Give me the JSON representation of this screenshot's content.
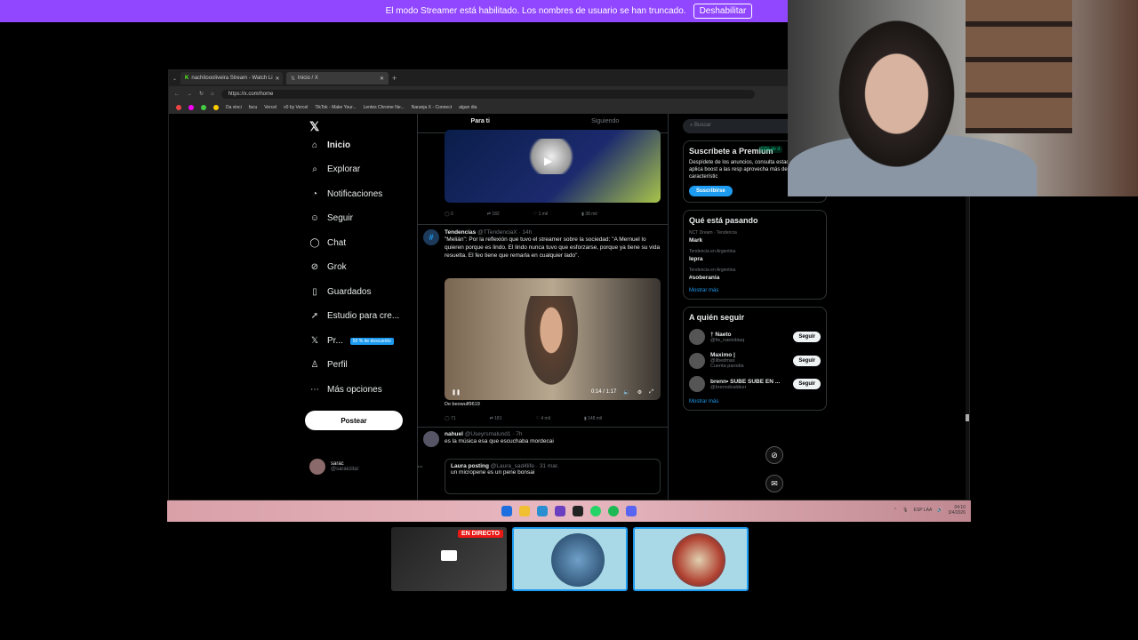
{
  "banner": {
    "text": "El modo Streamer está habilitado. Los nombres de usuario se han truncado.",
    "button": "Deshabilitar"
  },
  "browser": {
    "tabs": [
      {
        "label": "nachitoooliveira Stream - Watch Li"
      },
      {
        "label": "Inicio / X"
      }
    ],
    "url": "https://x.com/home",
    "bookmarks": [
      "Da vinci",
      "facu",
      "Vercel",
      "v0 by Vercel",
      "TikTok - Make Your...",
      "Lentes Chrome Ne...",
      "Naranja X - Connect",
      "algun dia"
    ]
  },
  "nav": {
    "items": [
      {
        "label": "Inicio",
        "icon": "home-icon"
      },
      {
        "label": "Explorar",
        "icon": "search-icon"
      },
      {
        "label": "Notificaciones",
        "icon": "bell-icon"
      },
      {
        "label": "Seguir",
        "icon": "follow-icon"
      },
      {
        "label": "Chat",
        "icon": "chat-icon"
      },
      {
        "label": "Grok",
        "icon": "grok-icon"
      },
      {
        "label": "Guardados",
        "icon": "bookmark-icon"
      },
      {
        "label": "Estudio para cre...",
        "icon": "rocket-icon"
      },
      {
        "label": "Pr...",
        "icon": "x-icon"
      },
      {
        "label": "Perfil",
        "icon": "person-icon"
      },
      {
        "label": "Más opciones",
        "icon": "more-icon"
      }
    ],
    "premium_badge": "50 % de descuento",
    "post_button": "Postear",
    "profile": {
      "name": "sarac",
      "handle": "@saraiciita/"
    }
  },
  "feed": {
    "tabs": [
      "Para ti",
      "Siguiendo"
    ],
    "first_actions": [
      "0",
      "182",
      "1 mil",
      "38 mil"
    ],
    "tweet1": {
      "name": "Tendencias",
      "handle": "@TTendenciaX · 14h",
      "text": "\"Melián\": Por la reflexión que tuvo el streamer sobre la sociedad: \"A Mernuel lo quieren porque es lindo. El lindo nunca tuvo que esforzarse, porque ya tiene su vida resuelta. El feo tiene que remarla en cualquier lado\".",
      "video_time": "0:14 / 1:17",
      "source": "De beowulf9619",
      "actions": [
        "71",
        "181",
        "4 mil",
        "148 mil"
      ]
    },
    "tweet2": {
      "name": "nahuel",
      "handle": "@Useyrsmalund1 · 7h",
      "text": "es la música esa que escuchaba mordecai",
      "quote_name": "Laura posting",
      "quote_handle": "@Laura_sad4life · 31 mar.",
      "quote_text": "un micropene es un pene bonsai"
    }
  },
  "right": {
    "search_placeholder": "Buscar",
    "premium": {
      "title": "Suscríbete a Premium",
      "badge": "50% de d",
      "text": "Despídete de los anuncios, consulta estadísticas, aplica boost a las resp aprovecha más de 20 característic",
      "button": "Suscribirse"
    },
    "trending": {
      "title": "Qué está pasando",
      "items": [
        {
          "context": "NCT Dream · Tendencia",
          "topic": "Mark"
        },
        {
          "context": "Tendencia en Argentina",
          "topic": "lepra"
        },
        {
          "context": "Tendencia en Argentina",
          "topic": "#soberania"
        }
      ],
      "more": "Mostrar más"
    },
    "who_to_follow": {
      "title": "A quién seguir",
      "accounts": [
        {
          "name": "† Naeto",
          "handle": "@fw_naetobiaq",
          "extra": ""
        },
        {
          "name": "Maximo |",
          "handle": "@libedmax",
          "extra": "Cuenta parodia"
        },
        {
          "name": "brenn• SUBE SUBE EN ...",
          "handle": "@brenndvaldezr",
          "extra": ""
        }
      ],
      "follow_label": "Seguir",
      "more": "Mostrar más"
    }
  },
  "taskbar": {
    "lang": "ESP LAA",
    "time": "04:10",
    "date": "3/4/2026"
  },
  "tiles": {
    "live_badge": "EN DIRECTO"
  },
  "colors": {
    "banner": "#9146ff",
    "accent": "#1d9bf0",
    "live": "#e91916"
  }
}
